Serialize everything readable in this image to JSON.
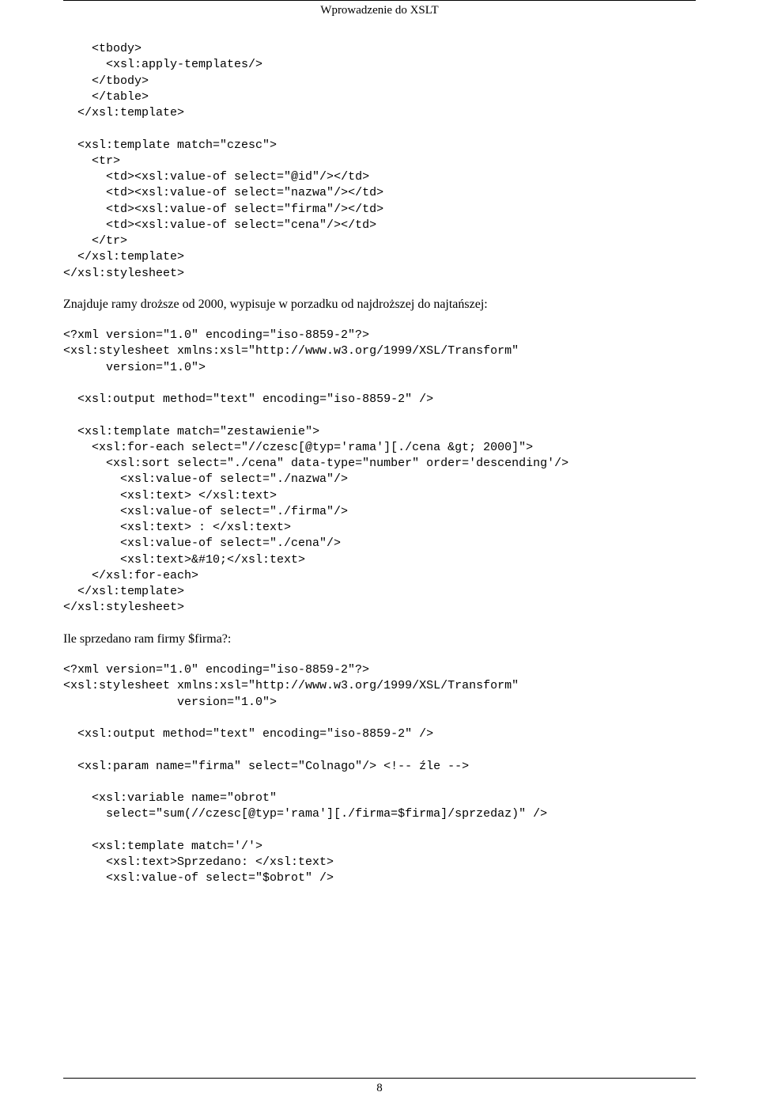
{
  "header": {
    "title": "Wprowadzenie do XSLT"
  },
  "blocks": {
    "code1": "    <tbody>\n      <xsl:apply-templates/>\n    </tbody>\n    </table>\n  </xsl:template>\n\n  <xsl:template match=\"czesc\">\n    <tr>\n      <td><xsl:value-of select=\"@id\"/></td>\n      <td><xsl:value-of select=\"nazwa\"/></td>\n      <td><xsl:value-of select=\"firma\"/></td>\n      <td><xsl:value-of select=\"cena\"/></td>\n    </tr>\n  </xsl:template>\n</xsl:stylesheet>",
    "prose1": "Znajduje ramy droższe od 2000, wypisuje w porzadku od najdroższej do najtańszej:",
    "code2": "<?xml version=\"1.0\" encoding=\"iso-8859-2\"?>\n<xsl:stylesheet xmlns:xsl=\"http://www.w3.org/1999/XSL/Transform\"\n      version=\"1.0\">\n\n  <xsl:output method=\"text\" encoding=\"iso-8859-2\" />\n\n  <xsl:template match=\"zestawienie\">\n    <xsl:for-each select=\"//czesc[@typ='rama'][./cena &gt; 2000]\">\n      <xsl:sort select=\"./cena\" data-type=\"number\" order='descending'/>\n        <xsl:value-of select=\"./nazwa\"/>\n        <xsl:text> </xsl:text>\n        <xsl:value-of select=\"./firma\"/>\n        <xsl:text> : </xsl:text>\n        <xsl:value-of select=\"./cena\"/>\n        <xsl:text>&#10;</xsl:text>\n    </xsl:for-each>\n  </xsl:template>\n</xsl:stylesheet>",
    "prose2": "Ile sprzedano ram firmy $firma?:",
    "code3": "<?xml version=\"1.0\" encoding=\"iso-8859-2\"?>\n<xsl:stylesheet xmlns:xsl=\"http://www.w3.org/1999/XSL/Transform\"\n                version=\"1.0\">\n\n  <xsl:output method=\"text\" encoding=\"iso-8859-2\" />\n\n  <xsl:param name=\"firma\" select=\"Colnago\"/> <!-- źle -->\n\n    <xsl:variable name=\"obrot\"\n      select=\"sum(//czesc[@typ='rama'][./firma=$firma]/sprzedaz)\" />\n\n    <xsl:template match='/'>\n      <xsl:text>Sprzedano: </xsl:text>\n      <xsl:value-of select=\"$obrot\" />"
  },
  "footer": {
    "page_number": "8"
  }
}
